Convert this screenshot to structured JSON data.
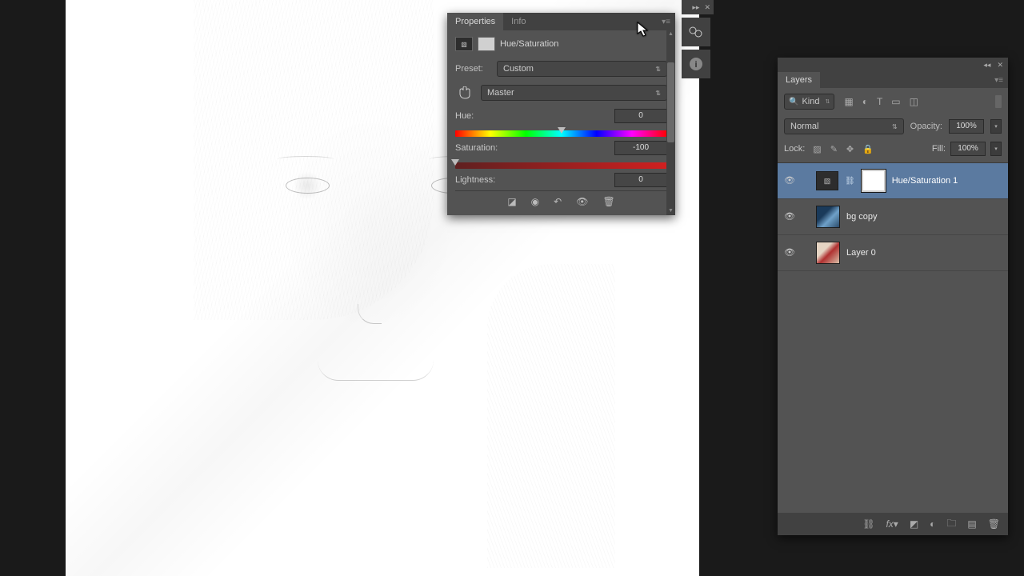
{
  "properties": {
    "tab_properties": "Properties",
    "tab_info": "Info",
    "adjustment_title": "Hue/Saturation",
    "preset_label": "Preset:",
    "preset_value": "Custom",
    "channel_value": "Master",
    "hue_label": "Hue:",
    "hue_value": "0",
    "sat_label": "Saturation:",
    "sat_value": "-100",
    "light_label": "Lightness:",
    "light_value": "0"
  },
  "layers": {
    "title": "Layers",
    "kind_label": "Kind",
    "blend_mode": "Normal",
    "opacity_label": "Opacity:",
    "opacity_value": "100%",
    "lock_label": "Lock:",
    "fill_label": "Fill:",
    "fill_value": "100%",
    "items": [
      {
        "name": "Hue/Saturation 1"
      },
      {
        "name": "bg copy"
      },
      {
        "name": "Layer 0"
      }
    ]
  }
}
